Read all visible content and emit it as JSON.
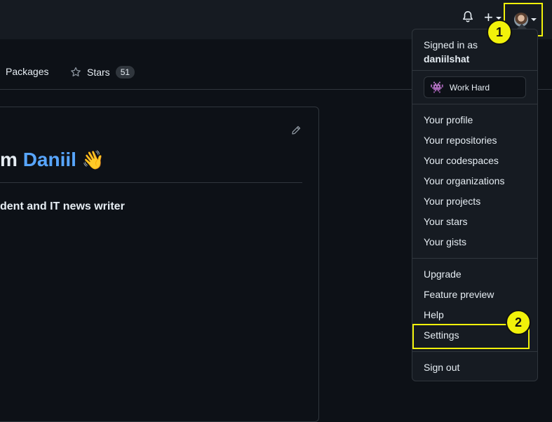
{
  "header": {
    "icons": {
      "notifications": "bell-icon",
      "create": "plus-icon",
      "avatar": "user-avatar"
    },
    "plus_label": "+"
  },
  "callouts": [
    "1",
    "2"
  ],
  "tabs": [
    {
      "label": "Packages"
    },
    {
      "label": "Stars",
      "count": "51",
      "icon": "star-icon"
    }
  ],
  "readme": {
    "heading_prefix": "m ",
    "heading_name": "Daniil",
    "heading_emoji": "👋",
    "subtitle": "dent and IT news writer",
    "edit_icon": "pencil-icon"
  },
  "menu": {
    "signed_in_as": "Signed in as",
    "username": "daniilshat",
    "status": {
      "emoji": "👾",
      "text": "Work Hard"
    },
    "group1": [
      "Your profile",
      "Your repositories",
      "Your codespaces",
      "Your organizations",
      "Your projects",
      "Your stars",
      "Your gists"
    ],
    "group2": [
      "Upgrade",
      "Feature preview",
      "Help",
      "Settings"
    ],
    "sign_out": "Sign out"
  },
  "colors": {
    "background": "#0d1117",
    "header": "#161b22",
    "accent_link": "#58a6ff",
    "highlight": "#f2f20a",
    "border": "#30363d"
  }
}
